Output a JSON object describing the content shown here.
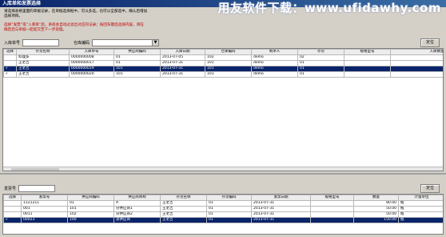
{
  "window": {
    "title": "入库单和发票选择",
    "watermark": "用友软件下载：www.ufidawhy.com"
  },
  "info": {
    "line1": "请选择表格里面的单据记录，在单据选择框中，可以多选，也可以全部选中，确认后增加",
    "line1b": "选择项目。",
    "line2": "选择“发票”或“入库单”后，系统会自动过滤出对应的记录；按回车键后选择内容，请在",
    "line2b": "确定后与单据一起提交至下一步处理。"
  },
  "top_filter": {
    "receipt_label": "入库单号",
    "receipt_value": "",
    "warehouse_label": "仓库编码",
    "warehouse_value": "",
    "locate_label": "定位"
  },
  "top_table": {
    "headers": [
      "选择",
      "存货名称",
      "入库单号",
      "供应商编码",
      "入库日期",
      "仓库编码",
      "制单人",
      "存货",
      "规格型号",
      "入库数量"
    ],
    "rows": [
      {
        "sel": "",
        "name": "料理多",
        "no": "0000000008",
        "sup": "01",
        "date": "2013-07-05",
        "wh": "102",
        "maker": "demo",
        "inv": "02",
        "spec": "",
        "qty": "1,000.00",
        "selected": false
      },
      {
        "sel": "",
        "name": "王老吉",
        "no": "0000000017",
        "sup": "01",
        "date": "2013-07-31",
        "wh": "101",
        "maker": "demo",
        "inv": "01",
        "spec": "",
        "qty": "50.00",
        "selected": false
      },
      {
        "sel": "√",
        "name": "王老吉",
        "no": "0000000019",
        "sup": "101",
        "date": "2013-07-31",
        "wh": "101",
        "maker": "demo",
        "inv": "01",
        "spec": "",
        "qty": "50.00",
        "selected": true
      },
      {
        "sel": "√",
        "name": "王老吉",
        "no": "0000000020",
        "sup": "101",
        "date": "2013-07-31",
        "wh": "101",
        "maker": "demo",
        "inv": "01",
        "spec": "",
        "qty": "50.00",
        "selected": false
      }
    ]
  },
  "bottom_filter": {
    "invoice_label": "发票号",
    "invoice_value": "",
    "locate_label": "定位"
  },
  "bottom_table": {
    "headers": [
      "选择",
      "发票号",
      "供应商编码",
      "供应商简称",
      "存货名称",
      "存货编码",
      "发票日期",
      "规格型号",
      "数量",
      "计量单位"
    ],
    "rows": [
      {
        "sel": "",
        "no": "1121211",
        "sup": "01",
        "sname": "A",
        "name": "王老吉",
        "code": "01",
        "date": "2013-07-31",
        "spec": "",
        "qty": "80.00",
        "unit": "瓶",
        "selected": false
      },
      {
        "sel": "",
        "no": "001",
        "sup": "101",
        "sname": "分供应商1",
        "name": "王老吉",
        "code": "01",
        "date": "2013-07-31",
        "spec": "",
        "qty": "50.00",
        "unit": "瓶",
        "selected": false
      },
      {
        "sel": "",
        "no": "0011",
        "sup": "102",
        "sname": "分供应商2",
        "name": "王老吉",
        "code": "01",
        "date": "2013-07-31",
        "spec": "",
        "qty": "50.00",
        "unit": "瓶",
        "selected": false
      },
      {
        "sel": "√",
        "no": "00023",
        "sup": "100",
        "sname": "总供应商",
        "name": "王老吉",
        "code": "01",
        "date": "2013-07-31",
        "spec": "",
        "qty": "150.00",
        "unit": "瓶",
        "selected": true
      }
    ]
  }
}
